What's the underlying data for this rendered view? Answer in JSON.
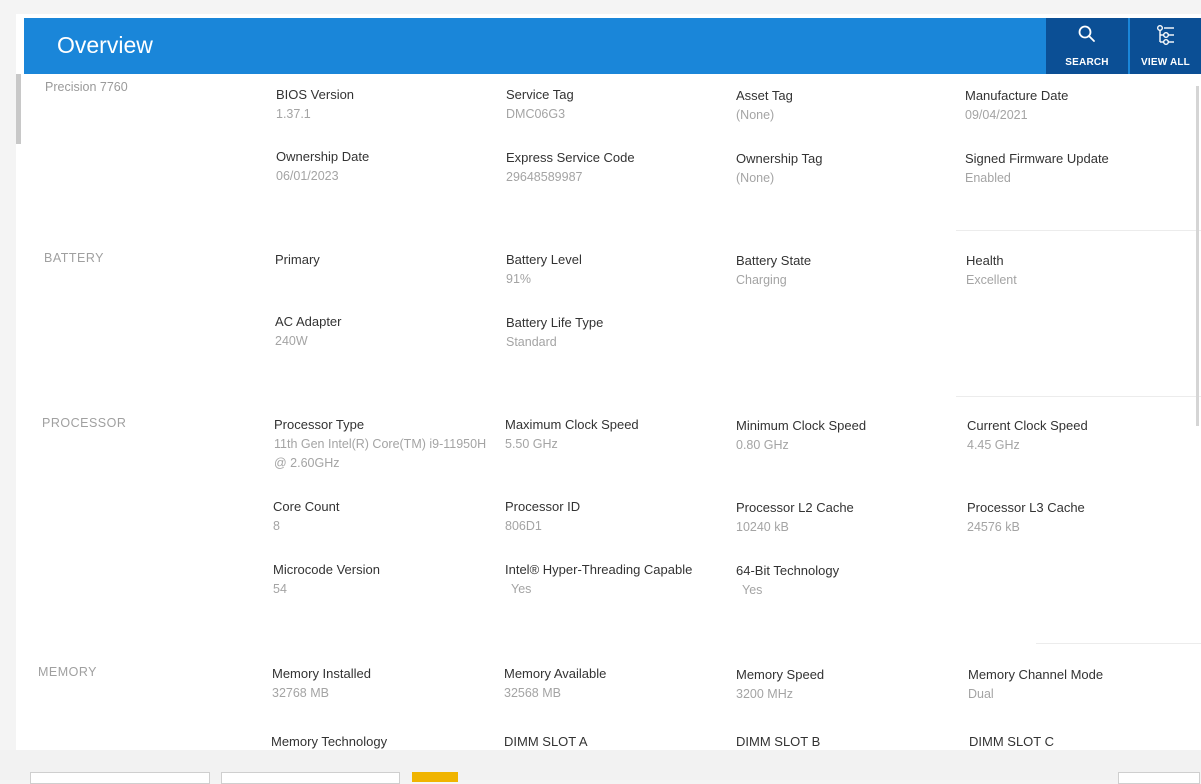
{
  "header": {
    "title": "Overview",
    "search_label": "SEARCH",
    "view_all_label": "VIEW ALL",
    "accent_color": "#1a86d9",
    "button_color": "#0b4f95"
  },
  "device": {
    "model": "Precision 7760"
  },
  "system": {
    "fields": [
      {
        "label": "BIOS Version",
        "value": "1.37.1"
      },
      {
        "label": "Service Tag",
        "value": "DMC06G3"
      },
      {
        "label": "Asset Tag",
        "value": "(None)"
      },
      {
        "label": "Manufacture Date",
        "value": "09/04/2021"
      },
      {
        "label": "Ownership Date",
        "value": "06/01/2023"
      },
      {
        "label": "Express Service Code",
        "value": "29648589987"
      },
      {
        "label": "Ownership Tag",
        "value": "(None)"
      },
      {
        "label": "Signed Firmware Update",
        "value": "Enabled"
      }
    ]
  },
  "battery": {
    "title": "BATTERY",
    "fields": [
      {
        "label": "Primary",
        "value": ""
      },
      {
        "label": "Battery Level",
        "value": "91%"
      },
      {
        "label": "Battery State",
        "value": "Charging"
      },
      {
        "label": "Health",
        "value": "Excellent"
      },
      {
        "label": "AC Adapter",
        "value": "240W"
      },
      {
        "label": "Battery Life Type",
        "value": "Standard"
      }
    ]
  },
  "processor": {
    "title": "PROCESSOR",
    "fields": [
      {
        "label": "Processor Type",
        "value": "11th Gen Intel(R) Core(TM) i9-11950H @ 2.60GHz"
      },
      {
        "label": "Maximum Clock Speed",
        "value": "5.50 GHz"
      },
      {
        "label": "Minimum Clock Speed",
        "value": "0.80 GHz"
      },
      {
        "label": "Current Clock Speed",
        "value": "4.45 GHz"
      },
      {
        "label": "Core Count",
        "value": "8"
      },
      {
        "label": "Processor ID",
        "value": "806D1"
      },
      {
        "label": "Processor L2 Cache",
        "value": "10240 kB"
      },
      {
        "label": "Processor L3 Cache",
        "value": "24576 kB"
      },
      {
        "label": "Microcode Version",
        "value": "54"
      },
      {
        "label": "Intel® Hyper-Threading Capable",
        "value": "Yes"
      },
      {
        "label": "64-Bit Technology",
        "value": "Yes"
      }
    ]
  },
  "memory": {
    "title": "MEMORY",
    "fields": [
      {
        "label": "Memory Installed",
        "value": "32768 MB"
      },
      {
        "label": "Memory Available",
        "value": "32568 MB"
      },
      {
        "label": "Memory Speed",
        "value": "3200 MHz"
      },
      {
        "label": "Memory Channel Mode",
        "value": "Dual"
      },
      {
        "label": "Memory Technology",
        "value": ""
      },
      {
        "label": "DIMM SLOT A",
        "value": ""
      },
      {
        "label": "DIMM SLOT B",
        "value": ""
      },
      {
        "label": "DIMM SLOT C",
        "value": ""
      }
    ]
  }
}
